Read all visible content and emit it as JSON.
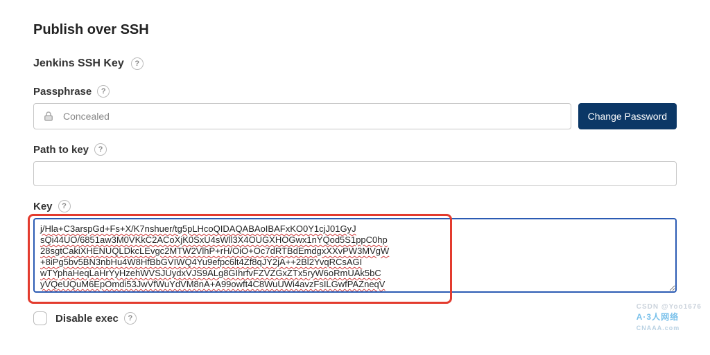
{
  "page_title": "Publish over SSH",
  "section_title": "Jenkins SSH Key",
  "help_glyph": "?",
  "passphrase": {
    "label": "Passphrase",
    "status_text": "Concealed",
    "change_button": "Change Password"
  },
  "path_to_key": {
    "label": "Path to key",
    "value": ""
  },
  "key": {
    "label": "Key",
    "value": "j/Hla+C3arspGd+Fs+X/K7nshuer/tg5pLHcoQIDAQABAoIBAFxKO0Y1cjJ01GyJ\nsQi44UO/6851aw3M0VKkC2ACoXjK0SxU4sWll3X4OUGXHOGwx1nYQod5S1ppC0hp\n28sgtCakiXHENUQLDkcLEvgc2MTW2VlhP+rH/OiO+Oc7dRTBdEmdgxXXvPW3MVgW\n+8iPg5bv5BN3nbHu4W8HfBbGVIWQ4Yu9efpc6lt4Zf8qJY2jA++2Bl2YvqRCsAGI\nwTYphaHeqLaHrYyHzehWVSJUydxVJS9ALg8GIhrfvFZVZGxZTx5ryW6oRmUAk5bC\nyVQeUQuM6EpOmdi53JwVfWuYdVM8nA+A99owft4C8WuUWi4avzFsILGwfPAZneqV"
  },
  "disable_exec": {
    "label": "Disable exec",
    "checked": false
  },
  "watermark": {
    "brand": "A·3人网络",
    "url": "CNAAA.com",
    "csdn": "CSDN @Yoo1676"
  }
}
